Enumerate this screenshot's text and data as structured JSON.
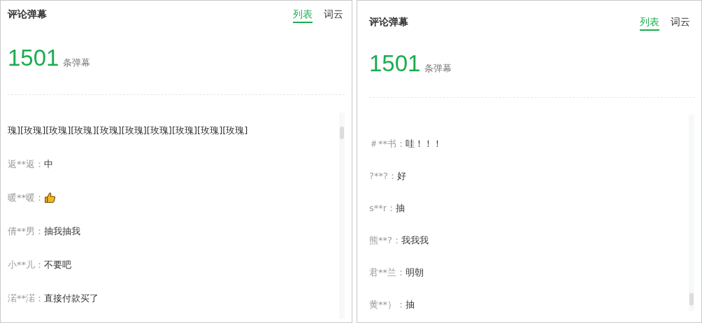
{
  "panels": [
    {
      "title": "评论弹幕",
      "tabs": [
        {
          "label": "列表",
          "selected": true
        },
        {
          "label": "词云",
          "selected": false
        }
      ],
      "count": "1501",
      "count_unit": "条弹幕",
      "comments": [
        {
          "kind": "text",
          "content": "瑰][玫瑰][玫瑰][玫瑰][玫瑰][玫瑰][玫瑰][玫瑰][玫瑰][玫瑰]"
        },
        {
          "kind": "text",
          "user": "返**返：",
          "content": "中"
        },
        {
          "kind": "emoji",
          "user": "暖**暖："
        },
        {
          "kind": "text",
          "user": "倩**男：",
          "content": "抽我抽我"
        },
        {
          "kind": "text",
          "user": "小**儿：",
          "content": "不要吧"
        },
        {
          "kind": "text",
          "user": "渃**渃：",
          "content": "直接付款买了"
        }
      ]
    },
    {
      "title": "评论弹幕",
      "tabs": [
        {
          "label": "列表",
          "selected": true
        },
        {
          "label": "词云",
          "selected": false
        }
      ],
      "count": "1501",
      "count_unit": "条弹幕",
      "comments": [
        {
          "kind": "text",
          "user": "＃**书：",
          "content": "哇！！！"
        },
        {
          "kind": "text",
          "user": "?**?：",
          "content": "好"
        },
        {
          "kind": "text",
          "user": "s**r：",
          "content": "抽"
        },
        {
          "kind": "text",
          "user": "熊**?：",
          "content": "我我我"
        },
        {
          "kind": "text",
          "user": "君**兰：",
          "content": "明朝"
        },
        {
          "kind": "text",
          "user": "黄**）：",
          "content": "抽"
        }
      ]
    }
  ]
}
